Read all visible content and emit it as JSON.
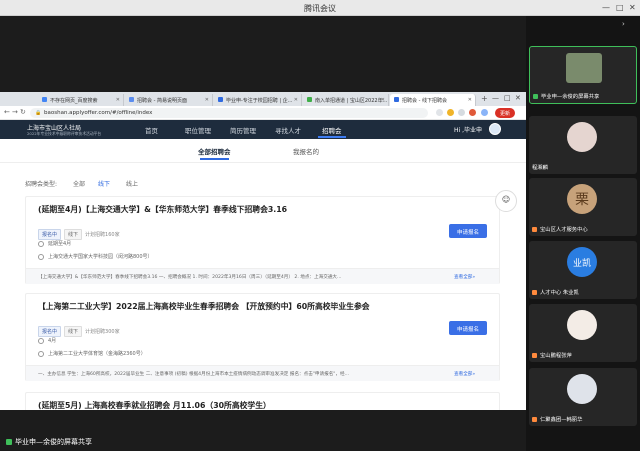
{
  "window": {
    "title": "腾讯会议"
  },
  "browser": {
    "tabs": [
      {
        "label": "不存在网页_百度搜索",
        "color": "#4285f4"
      },
      {
        "label": "招聘会 - 简易说明页面",
        "color": "#5b8def"
      },
      {
        "label": "毕业申-专注于校园招聘 | 企...",
        "color": "#2f6ae0"
      },
      {
        "label": "南入单招通道 | 宝山区2022年...",
        "color": "#3fae49"
      },
      {
        "label": "招聘会 - 线下招聘会",
        "color": "#2f6ae0"
      }
    ],
    "url": "baoshan.applyoffer.com/#/offline/index",
    "update_label": "更新"
  },
  "site": {
    "logo_main": "上海市宝山区人社局",
    "logo_sub": "2022年专业技术中级职称评审技术活动平台",
    "nav": [
      "首页",
      "职位管理",
      "简历管理",
      "寻找人才",
      "招聘会"
    ],
    "nav_active": 4,
    "user": "Hi ,毕业申",
    "subtabs": [
      "全部招聘会",
      "我报名的"
    ],
    "filter_label": "招聘会类型:",
    "filters": [
      "全部",
      "线下",
      "线上"
    ],
    "filter_active": 1,
    "cards": [
      {
        "title": "(延期至4月)【上海交通大学】&【华东师范大学】春季线下招聘会3.16",
        "tags": [
          "报名中",
          "线下"
        ],
        "plan": "计划招聘160家",
        "date": "延期至4月",
        "place": "上海交通大学国家大学科技园（闵河路800号）",
        "desc": "【上海交通大学】&【华东师范大学】春季线下招聘会3.16 一、招聘会概况 1. 时间：2022年3月16日（周三）（延期至4月） 2. 地点：上海交通大...",
        "more": "查看全部»",
        "apply": "申请报名"
      },
      {
        "title": "【上海第二工业大学】2022届上海高校毕业生春季招聘会 【开放预约中】60所高校毕业生参会",
        "tags": [
          "报名中",
          "线下"
        ],
        "plan": "计划招聘300家",
        "date": "4月",
        "place": "上海第二工业大学体育馆（金海路2360号）",
        "desc": "一、主办信息 学生：上海60所高校，2022届毕业生 二、注意事项 (初稿) 根据4月份上海市本土疫情病例动态调审准发决定 报名：点击\"申请报名\"，经...",
        "more": "查看全部»",
        "apply": "申请报名"
      },
      {
        "title": "(延期至5月) 上海高校春季就业招聘会 月11.06（30所高校学生）"
      }
    ]
  },
  "share_label": "毕业申—余俊的屏幕共享",
  "participants": [
    {
      "name": "毕业申—余俊的屏幕共享",
      "active": true
    },
    {
      "name": "程湘麟",
      "active": false
    },
    {
      "name": "宝山区人才服务中心",
      "active": false
    },
    {
      "name": "人才中心 朱业凯",
      "active": false
    },
    {
      "name": "宝山鹏程张萍",
      "active": false
    },
    {
      "name": "仁聚鑫团—韩丽华",
      "active": false
    }
  ],
  "avatar_text": {
    "p3": "栗",
    "p4": "业凯"
  }
}
